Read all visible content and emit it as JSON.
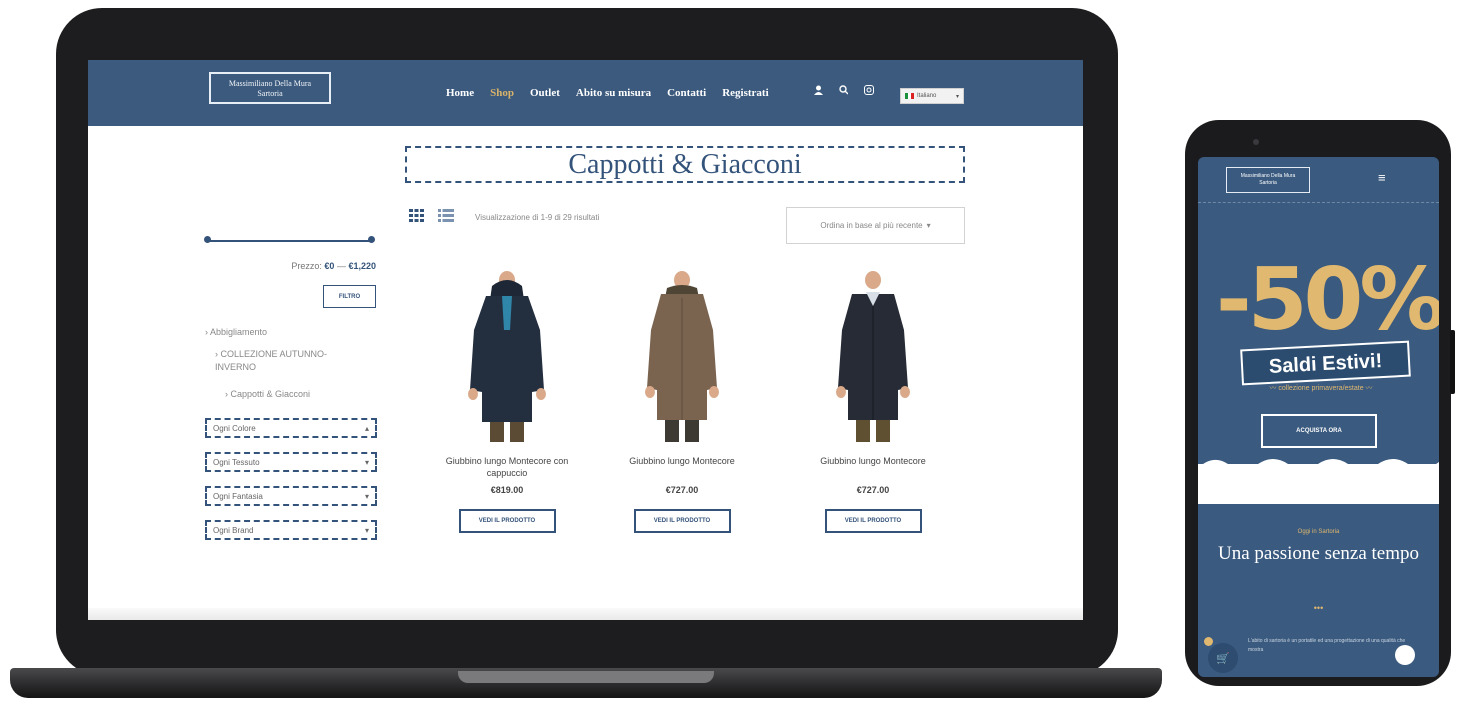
{
  "site": {
    "logo_line1": "Massimiliano Della Mura",
    "logo_line2": "Sartoria"
  },
  "nav": {
    "links": [
      "Home",
      "Shop",
      "Outlet",
      "Abito su misura",
      "Contatti",
      "Registrati"
    ],
    "active": "Shop",
    "language": "Italiano"
  },
  "icons": {
    "user": "user-icon",
    "search": "search-icon",
    "instagram": "instagram-icon",
    "grid": "grid-view-icon",
    "list": "list-view-icon",
    "cart": "cart-icon",
    "menu": "hamburger-menu-icon",
    "chat": "chat-icon"
  },
  "colors": {
    "brand": "#3b5a7e",
    "accent": "#d9b36a"
  },
  "shop": {
    "title": "Cappotti & Giacconi",
    "results": "Visualizzazione di 1-9 di 29 risultati",
    "sort": "Ordina in base al più recente"
  },
  "sidebar": {
    "price_prefix": "Prezzo:",
    "price_min": "€0",
    "price_sep": "—",
    "price_max": "€1,220",
    "filter_button": "FILTRO",
    "categories": [
      "Abbigliamento",
      "COLLEZIONE AUTUNNO-INVERNO",
      "Cappotti & Giacconi"
    ],
    "dropdowns": [
      "Ogni Colore",
      "Ogni Tessuto",
      "Ogni Fantasia",
      "Ogni Brand"
    ]
  },
  "products": [
    {
      "name": "Giubbino lungo Montecore con cappuccio",
      "price": "€819.00",
      "button": "VEDI IL PRODOTTO"
    },
    {
      "name": "Giubbino lungo Montecore",
      "price": "€727.00",
      "button": "VEDI IL PRODOTTO"
    },
    {
      "name": "Giubbino lungo Montecore",
      "price": "€727.00",
      "button": "VEDI IL PRODOTTO"
    }
  ],
  "mobile": {
    "sale": "-50%",
    "banner": "Saldi Estivi!",
    "sub": "collezione primavera/estate",
    "cta": "ACQUISTA ORA",
    "kicker": "Oggi in Sartoria",
    "headline": "Una passione senza tempo",
    "dots": "•••",
    "paragraph": "L'abito di sartoria è un portatile ed una progettazione di una qualità che mostra"
  }
}
